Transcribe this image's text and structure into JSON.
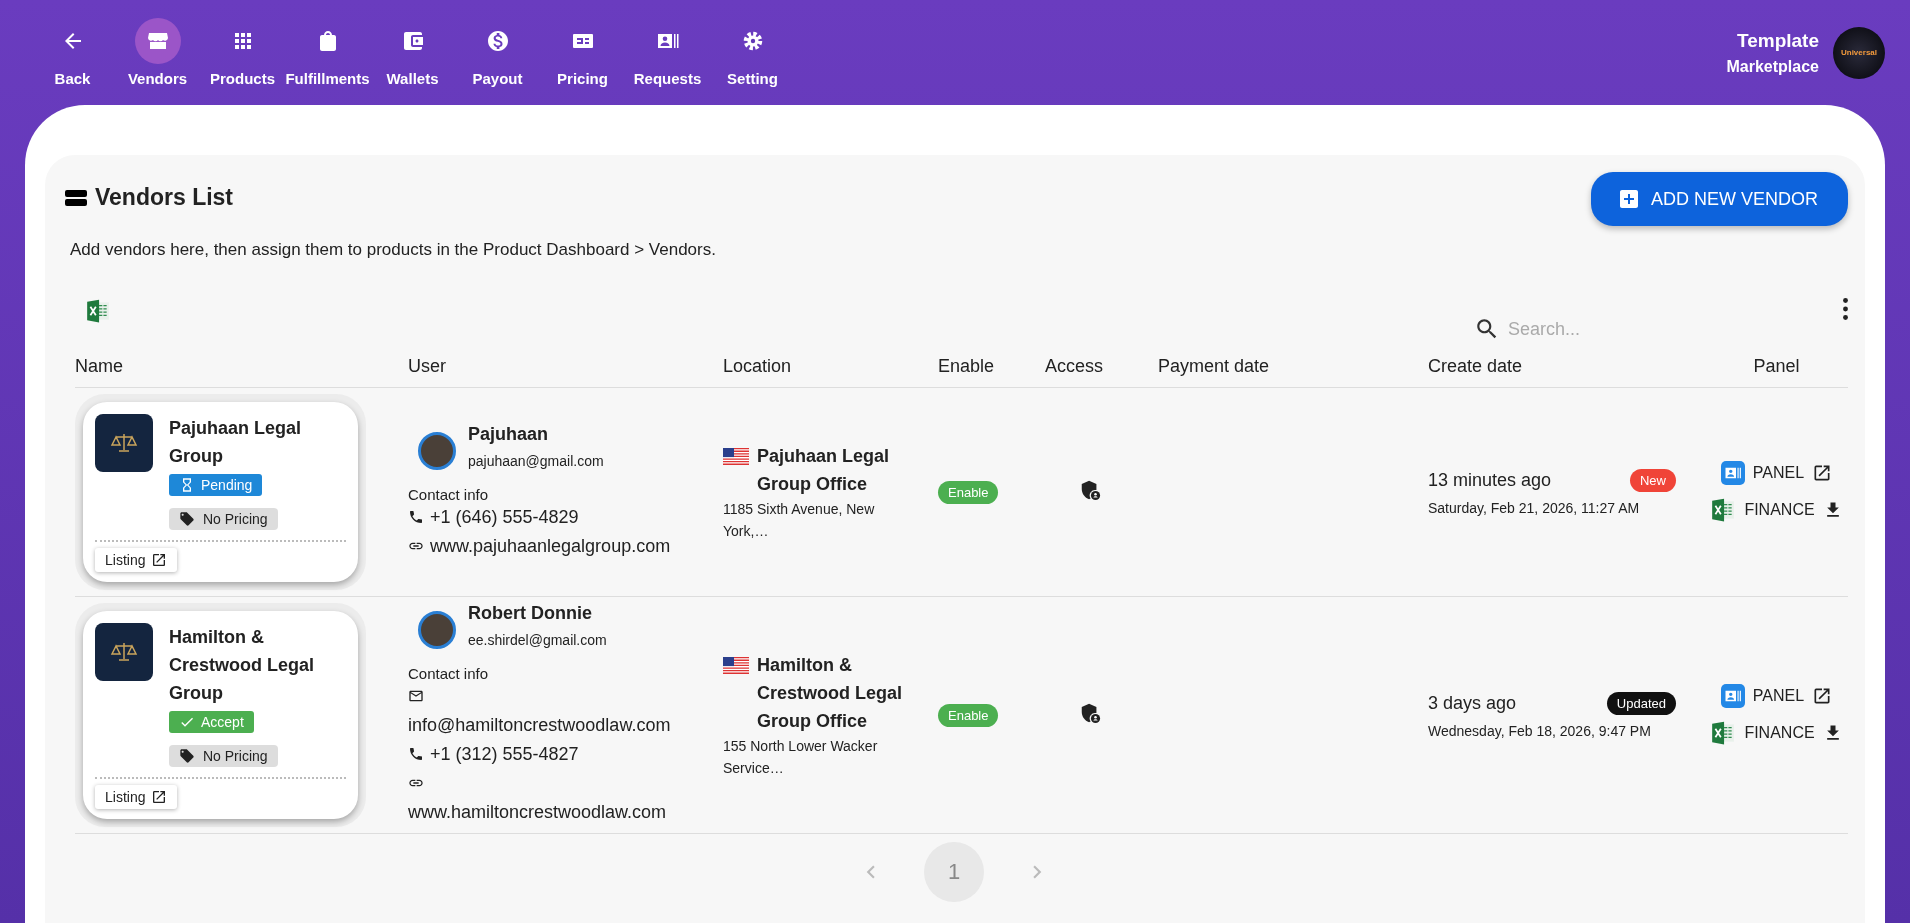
{
  "nav": {
    "items": [
      {
        "label": "Back",
        "selected": false
      },
      {
        "label": "Vendors",
        "selected": true
      },
      {
        "label": "Products",
        "selected": false
      },
      {
        "label": "Fulfillments",
        "selected": false
      },
      {
        "label": "Wallets",
        "selected": false
      },
      {
        "label": "Payout",
        "selected": false
      },
      {
        "label": "Pricing",
        "selected": false
      },
      {
        "label": "Requests",
        "selected": false
      },
      {
        "label": "Setting",
        "selected": false
      }
    ],
    "brand": {
      "title": "Template",
      "subtitle": "Marketplace",
      "logo_text": "Universal"
    }
  },
  "panel": {
    "title": "Vendors List",
    "add_button": "ADD NEW VENDOR",
    "description": "Add vendors here, then assign them to products in the Product Dashboard > Vendors.",
    "search": {
      "placeholder": "Search..."
    },
    "table": {
      "columns": [
        "Name",
        "User",
        "Location",
        "Enable",
        "Access",
        "Payment date",
        "Create date",
        "Panel"
      ],
      "rows": [
        {
          "name": "Pajuhaan Legal Group",
          "status": {
            "kind": "pending",
            "label": "Pending"
          },
          "pricing": "No Pricing",
          "listing": "Listing",
          "user": {
            "name": "Pajuhaan",
            "email": "pajuhaan@gmail.com",
            "contact_label": "Contact info",
            "contacts": [
              {
                "kind": "phone",
                "text": "+1 (646) 555-4829"
              },
              {
                "kind": "web",
                "text": "www.pajuhaanlegalgroup.com"
              }
            ]
          },
          "location": {
            "name": "Pajuhaan Legal Group Office",
            "address": "1185 Sixth Avenue, New York,…"
          },
          "enable": "Enable",
          "created": {
            "relative": "13 minutes ago",
            "badge": {
              "kind": "new",
              "label": "New"
            },
            "date": "Saturday, Feb 21, 2026, 11:27 AM"
          },
          "panel_link": "PANEL",
          "finance_link": "FINANCE"
        },
        {
          "name": "Hamilton & Crestwood Legal Group",
          "status": {
            "kind": "accepted",
            "label": "Accept"
          },
          "pricing": "No Pricing",
          "listing": "Listing",
          "user": {
            "name": "Robert Donnie",
            "email": "ee.shirdel@gmail.com",
            "contact_label": "Contact info",
            "contacts": [
              {
                "kind": "email",
                "text": "info@hamiltoncrestwoodlaw.com"
              },
              {
                "kind": "phone",
                "text": "+1 (312) 555-4827"
              },
              {
                "kind": "web",
                "text": "www.hamiltoncrestwoodlaw.com"
              }
            ]
          },
          "location": {
            "name": "Hamilton & Crestwood Legal Group Office",
            "address": "155 North Lower Wacker Service…"
          },
          "enable": "Enable",
          "created": {
            "relative": "3 days ago",
            "badge": {
              "kind": "updated",
              "label": "Updated"
            },
            "date": "Wednesday, Feb 18, 2026, 9:47 PM"
          },
          "panel_link": "PANEL",
          "finance_link": "FINANCE"
        }
      ]
    },
    "pagination": {
      "pages": [
        {
          "label": "1",
          "selected": true
        }
      ]
    }
  }
}
